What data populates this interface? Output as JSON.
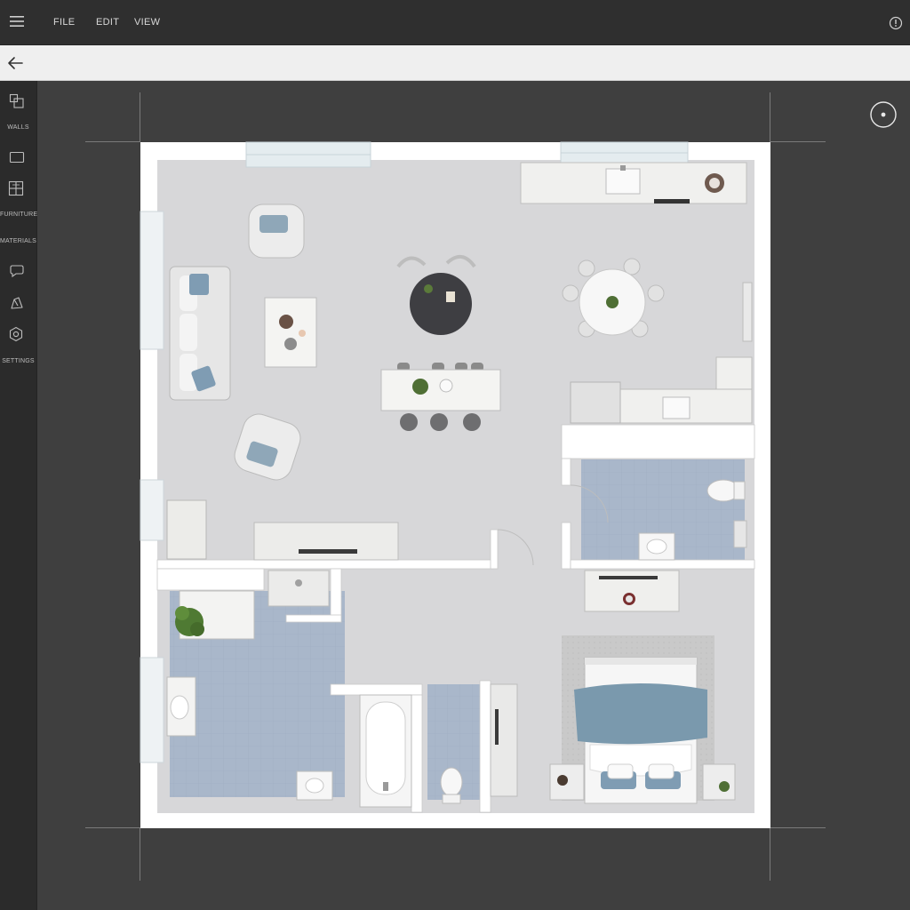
{
  "menu": {
    "items": [
      "FILE",
      "EDIT",
      "VIEW"
    ],
    "icons": {
      "left": "hamburger-menu-icon",
      "right": "info-icon"
    }
  },
  "toolbar": {
    "back_icon": "arrow-left-icon"
  },
  "sidebar": {
    "tools": [
      {
        "icon": "walls-tool-icon",
        "label": "WALLS"
      },
      {
        "icon": "rectangle-tool-icon",
        "label": ""
      },
      {
        "icon": "grid-tool-icon",
        "label": "FURNITURE"
      },
      {
        "icon": "materials-tool-icon",
        "label": "MATERIALS"
      },
      {
        "icon": "chat-tool-icon",
        "label": ""
      },
      {
        "icon": "pen-tool-icon",
        "label": ""
      },
      {
        "icon": "settings-tool-icon",
        "label": "SETTINGS"
      }
    ]
  },
  "canvas": {
    "recenter_icon": "target-icon",
    "colors": {
      "background": "#3f3f3f",
      "floor": "#d6d6d8",
      "tile_floor": "#a8b6c9",
      "wall": "#ffffff",
      "accent_blue": "#7f9cb3"
    }
  }
}
